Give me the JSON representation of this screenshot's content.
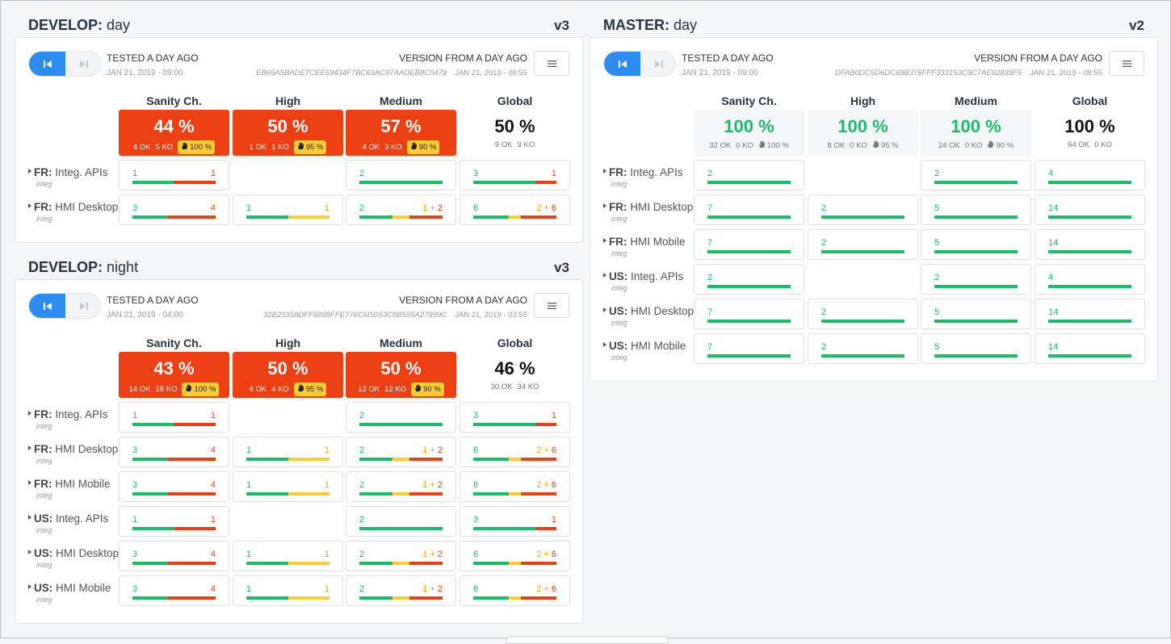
{
  "columns": [
    "Sanity Ch.",
    "High",
    "Medium",
    "Global"
  ],
  "icons": {
    "prev": "skip-previous-icon",
    "next": "skip-next-icon",
    "menu": "hamburger-menu-icon",
    "hand": "hand-icon"
  },
  "colors": {
    "ok": "#19be6b",
    "ko": "#ed3f14",
    "warn": "#ffcc33",
    "primary": "#2d8cf0"
  },
  "sections": [
    {
      "id": "develop-day",
      "branch": "DEVELOP:",
      "period": "day",
      "version": "v3",
      "tested": "TESTED A DAY AGO",
      "tested_date": "JAN 21, 2019 - 09:00",
      "version_label": "VERSION FROM A DAY AGO",
      "hash": "EB65A5BADE7CEE69434F7BC69AC97AADEB8C0479",
      "version_date": "JAN 21, 2019 - 08:55",
      "summary": [
        {
          "pct": "44 %",
          "ok": "4 OK",
          "ko": "5 KO",
          "prio": "100 %",
          "state": "fail"
        },
        {
          "pct": "50 %",
          "ok": "1 OK",
          "ko": "1 KO",
          "prio": "95 %",
          "state": "fail"
        },
        {
          "pct": "57 %",
          "ok": "4 OK",
          "ko": "3 KO",
          "prio": "90 %",
          "state": "fail"
        },
        {
          "pct": "50 %",
          "ok": "9 OK",
          "ko": "9 KO",
          "prio": "",
          "state": "global"
        }
      ],
      "rows": [
        {
          "country": "FR:",
          "name": "Integ. APIs",
          "sub": "integ",
          "cells": [
            {
              "ok": 1,
              "warn": 0,
              "ko": 1
            },
            null,
            {
              "ok": 2,
              "warn": 0,
              "ko": 0
            },
            {
              "ok": 3,
              "warn": 0,
              "ko": 1
            }
          ]
        },
        {
          "country": "FR:",
          "name": "HMI Desktop",
          "sub": "integ",
          "cells": [
            {
              "ok": 3,
              "warn": 0,
              "ko": 4
            },
            {
              "ok": 1,
              "warn": 1,
              "ko": 0
            },
            {
              "ok": 2,
              "warn": 1,
              "ko": 2
            },
            {
              "ok": 6,
              "warn": 2,
              "ko": 6
            }
          ]
        }
      ]
    },
    {
      "id": "develop-night",
      "branch": "DEVELOP:",
      "period": "night",
      "version": "v3",
      "tested": "TESTED A DAY AGO",
      "tested_date": "JAN 21, 2019 - 04:00",
      "version_label": "VERSION FROM A DAY AGO",
      "hash": "32B23358DFF6888FFE776C6DD53C8B555A27999C",
      "version_date": "JAN 21, 2019 - 03:55",
      "summary": [
        {
          "pct": "43 %",
          "ok": "14 OK",
          "ko": "18 KO",
          "prio": "100 %",
          "state": "fail"
        },
        {
          "pct": "50 %",
          "ok": "4 OK",
          "ko": "4 KO",
          "prio": "95 %",
          "state": "fail"
        },
        {
          "pct": "50 %",
          "ok": "12 OK",
          "ko": "12 KO",
          "prio": "90 %",
          "state": "fail"
        },
        {
          "pct": "46 %",
          "ok": "30 OK",
          "ko": "34 KO",
          "prio": "",
          "state": "global"
        }
      ],
      "rows": [
        {
          "country": "FR:",
          "name": "Integ. APIs",
          "sub": "integ",
          "cells": [
            {
              "ok": 1,
              "warn": 0,
              "ko": 1
            },
            null,
            {
              "ok": 2,
              "warn": 0,
              "ko": 0
            },
            {
              "ok": 3,
              "warn": 0,
              "ko": 1
            }
          ]
        },
        {
          "country": "FR:",
          "name": "HMI Desktop",
          "sub": "integ",
          "cells": [
            {
              "ok": 3,
              "warn": 0,
              "ko": 4
            },
            {
              "ok": 1,
              "warn": 1,
              "ko": 0
            },
            {
              "ok": 2,
              "warn": 1,
              "ko": 2
            },
            {
              "ok": 6,
              "warn": 2,
              "ko": 6
            }
          ]
        },
        {
          "country": "FR:",
          "name": "HMI Mobile",
          "sub": "integ",
          "cells": [
            {
              "ok": 3,
              "warn": 0,
              "ko": 4
            },
            {
              "ok": 1,
              "warn": 1,
              "ko": 0
            },
            {
              "ok": 2,
              "warn": 1,
              "ko": 2
            },
            {
              "ok": 6,
              "warn": 2,
              "ko": 6
            }
          ]
        },
        {
          "country": "US:",
          "name": "Integ. APIs",
          "sub": "integ",
          "cells": [
            {
              "ok": 1,
              "warn": 0,
              "ko": 1
            },
            null,
            {
              "ok": 2,
              "warn": 0,
              "ko": 0
            },
            {
              "ok": 3,
              "warn": 0,
              "ko": 1
            }
          ]
        },
        {
          "country": "US:",
          "name": "HMI Desktop",
          "sub": "integ",
          "cells": [
            {
              "ok": 3,
              "warn": 0,
              "ko": 4
            },
            {
              "ok": 1,
              "warn": 1,
              "ko": 0
            },
            {
              "ok": 2,
              "warn": 1,
              "ko": 2
            },
            {
              "ok": 6,
              "warn": 2,
              "ko": 6
            }
          ]
        },
        {
          "country": "US:",
          "name": "HMI Mobile",
          "sub": "integ",
          "cells": [
            {
              "ok": 3,
              "warn": 0,
              "ko": 4
            },
            {
              "ok": 1,
              "warn": 1,
              "ko": 0
            },
            {
              "ok": 2,
              "warn": 1,
              "ko": 2
            },
            {
              "ok": 6,
              "warn": 2,
              "ko": 6
            }
          ]
        }
      ]
    },
    {
      "id": "master-day",
      "branch": "MASTER:",
      "period": "day",
      "version": "v2",
      "tested": "TESTED A DAY AGO",
      "tested_date": "JAN 21, 2019 - 09:00",
      "version_label": "VERSION FROM A DAY AGO",
      "hash": "DFAB0DC5D6DC69B376FFF333153C9C7AE92839F5",
      "version_date": "JAN 21, 2019 - 08:55",
      "summary": [
        {
          "pct": "100 %",
          "ok": "32 OK",
          "ko": "0 KO",
          "prio": "100 %",
          "state": "ok"
        },
        {
          "pct": "100 %",
          "ok": "8 OK",
          "ko": "0 KO",
          "prio": "95 %",
          "state": "ok"
        },
        {
          "pct": "100 %",
          "ok": "24 OK",
          "ko": "0 KO",
          "prio": "90 %",
          "state": "ok"
        },
        {
          "pct": "100 %",
          "ok": "64 OK",
          "ko": "0 KO",
          "prio": "",
          "state": "global"
        }
      ],
      "rows": [
        {
          "country": "FR:",
          "name": "Integ. APIs",
          "sub": "integ",
          "cells": [
            {
              "ok": 2,
              "warn": 0,
              "ko": 0
            },
            null,
            {
              "ok": 2,
              "warn": 0,
              "ko": 0
            },
            {
              "ok": 4,
              "warn": 0,
              "ko": 0
            }
          ]
        },
        {
          "country": "FR:",
          "name": "HMI Desktop",
          "sub": "integ",
          "cells": [
            {
              "ok": 7,
              "warn": 0,
              "ko": 0
            },
            {
              "ok": 2,
              "warn": 0,
              "ko": 0
            },
            {
              "ok": 5,
              "warn": 0,
              "ko": 0
            },
            {
              "ok": 14,
              "warn": 0,
              "ko": 0
            }
          ]
        },
        {
          "country": "FR:",
          "name": "HMI Mobile",
          "sub": "integ",
          "cells": [
            {
              "ok": 7,
              "warn": 0,
              "ko": 0
            },
            {
              "ok": 2,
              "warn": 0,
              "ko": 0
            },
            {
              "ok": 5,
              "warn": 0,
              "ko": 0
            },
            {
              "ok": 14,
              "warn": 0,
              "ko": 0
            }
          ]
        },
        {
          "country": "US:",
          "name": "Integ. APIs",
          "sub": "integ",
          "cells": [
            {
              "ok": 2,
              "warn": 0,
              "ko": 0
            },
            null,
            {
              "ok": 2,
              "warn": 0,
              "ko": 0
            },
            {
              "ok": 4,
              "warn": 0,
              "ko": 0
            }
          ]
        },
        {
          "country": "US:",
          "name": "HMI Desktop",
          "sub": "integ",
          "cells": [
            {
              "ok": 7,
              "warn": 0,
              "ko": 0
            },
            {
              "ok": 2,
              "warn": 0,
              "ko": 0
            },
            {
              "ok": 5,
              "warn": 0,
              "ko": 0
            },
            {
              "ok": 14,
              "warn": 0,
              "ko": 0
            }
          ]
        },
        {
          "country": "US:",
          "name": "HMI Mobile",
          "sub": "integ",
          "cells": [
            {
              "ok": 7,
              "warn": 0,
              "ko": 0
            },
            {
              "ok": 2,
              "warn": 0,
              "ko": 0
            },
            {
              "ok": 5,
              "warn": 0,
              "ko": 0
            },
            {
              "ok": 14,
              "warn": 0,
              "ko": 0
            }
          ]
        }
      ]
    }
  ]
}
